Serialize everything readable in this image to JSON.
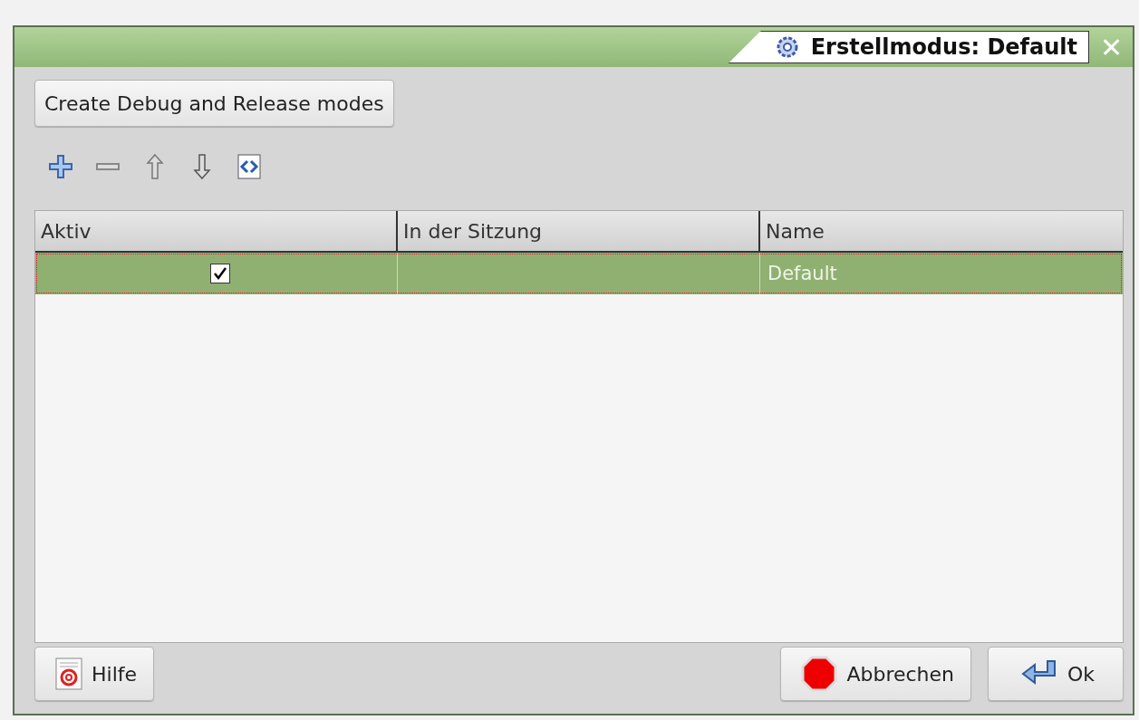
{
  "window": {
    "title": "Erstellmodus: Default",
    "close": "✕"
  },
  "create_button": "Create Debug and Release modes",
  "table": {
    "columns": [
      "Aktiv",
      "In der Sitzung",
      "Name"
    ],
    "rows": [
      {
        "active": true,
        "in_session": "",
        "name": "Default",
        "selected": true
      }
    ]
  },
  "buttons": [
    {
      "kind": "help",
      "label": "Hilfe"
    },
    {
      "kind": "cancel",
      "label": "Abbrechen"
    },
    {
      "kind": "ok",
      "label": "Ok"
    }
  ]
}
